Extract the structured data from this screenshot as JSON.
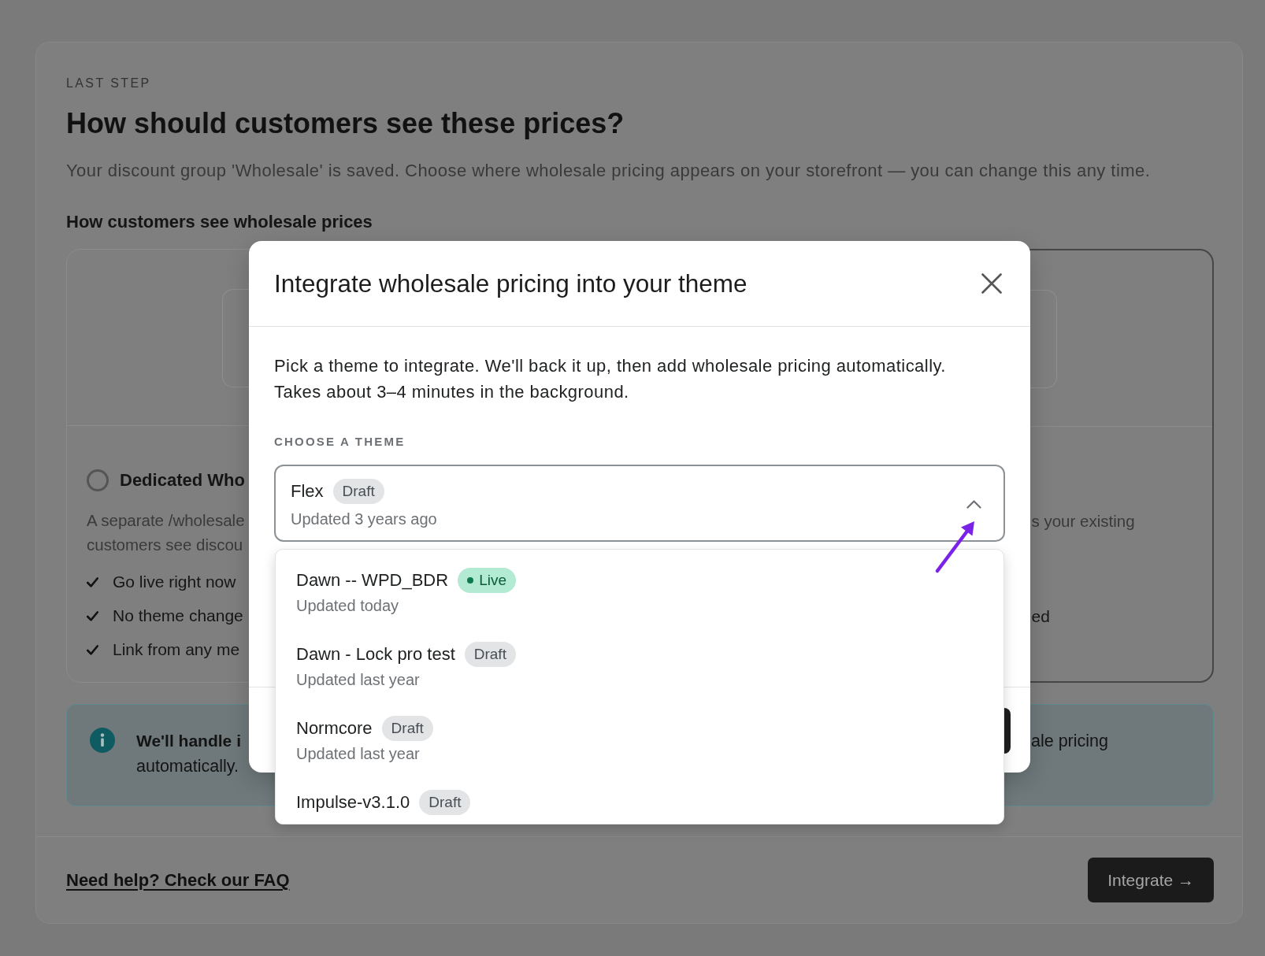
{
  "page": {
    "eyebrow": "LAST STEP",
    "title": "How should customers see these prices?",
    "description": "Your discount group 'Wholesale' is saved. Choose where wholesale pricing appears on your storefront — you can change this any time.",
    "section_title": "How customers see wholesale prices",
    "options": [
      {
        "kind": "head",
        "selected": false,
        "title": "Dedicated Who",
        "description_lines": [
          "A separate /wholesale",
          "customers see discou"
        ],
        "features": [
          "Go live right now",
          "No theme change",
          "Link from any me"
        ]
      },
      {
        "kind": "tail",
        "selected": true,
        "description_lines": [
          "s your existing"
        ],
        "features": [
          "ed"
        ]
      }
    ],
    "notice": {
      "heading": "We'll handle i",
      "body": "automatically.",
      "tail": "ale pricing"
    },
    "help_link": "Need help? Check our FAQ",
    "primary_button": "Integrate →"
  },
  "dialog": {
    "title": "Integrate wholesale pricing into your theme",
    "intro_lines": [
      "Pick a theme to integrate. We'll back it up, then add wholesale pricing automatically.",
      "Takes about 3–4 minutes in the background."
    ],
    "field_label": "CHOOSE A THEME",
    "theme_select": {
      "expanded": true,
      "name": "Flex",
      "kind": "draft",
      "status": "Draft",
      "updated": "Updated 3 years ago"
    },
    "themes": [
      {
        "name": "Dawn -- WPD_BDR",
        "kind": "live",
        "status": "Live",
        "updated": "Updated today",
        "selected": false
      },
      {
        "name": "Dawn - Lock pro test",
        "kind": "draft",
        "status": "Draft",
        "updated": "Updated last year",
        "selected": false
      },
      {
        "name": "Normcore",
        "kind": "draft",
        "status": "Draft",
        "updated": "Updated last year",
        "selected": false
      },
      {
        "name": "Impulse-v3.1.0",
        "kind": "draft",
        "status": "Draft",
        "selected": false
      }
    ]
  }
}
